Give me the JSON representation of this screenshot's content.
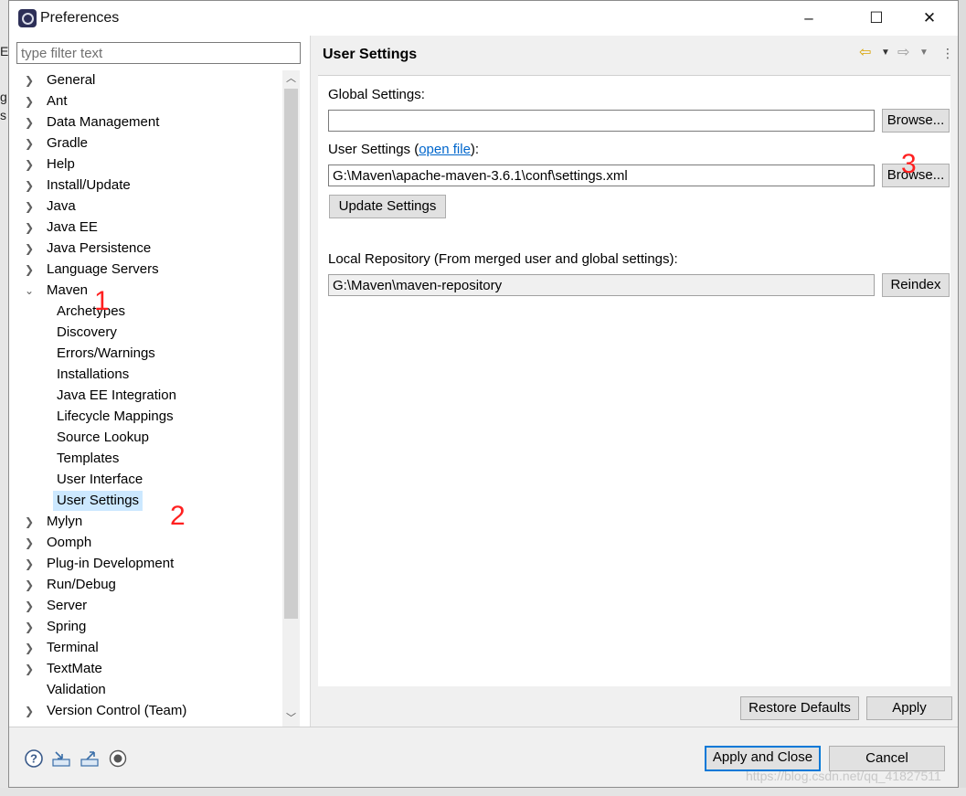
{
  "window": {
    "title": "Preferences",
    "minimize_glyph": "–",
    "maximize_glyph": "☐",
    "close_glyph": "✕"
  },
  "background": {
    "left_letters": [
      "E",
      "g",
      "s"
    ]
  },
  "filter": {
    "placeholder": "type filter text"
  },
  "tree": {
    "items": [
      {
        "label": "General",
        "expandable": true
      },
      {
        "label": "Ant",
        "expandable": true
      },
      {
        "label": "Data Management",
        "expandable": true
      },
      {
        "label": "Gradle",
        "expandable": true
      },
      {
        "label": "Help",
        "expandable": true
      },
      {
        "label": "Install/Update",
        "expandable": true
      },
      {
        "label": "Java",
        "expandable": true
      },
      {
        "label": "Java EE",
        "expandable": true
      },
      {
        "label": "Java Persistence",
        "expandable": true
      },
      {
        "label": "Language Servers",
        "expandable": true
      },
      {
        "label": "Maven",
        "expandable": true,
        "expanded": true
      },
      {
        "label": "Mylyn",
        "expandable": true
      },
      {
        "label": "Oomph",
        "expandable": true
      },
      {
        "label": "Plug-in Development",
        "expandable": true
      },
      {
        "label": "Run/Debug",
        "expandable": true
      },
      {
        "label": "Server",
        "expandable": true
      },
      {
        "label": "Spring",
        "expandable": true
      },
      {
        "label": "Terminal",
        "expandable": true
      },
      {
        "label": "TextMate",
        "expandable": true
      },
      {
        "label": "Validation",
        "expandable": false
      },
      {
        "label": "Version Control (Team)",
        "expandable": true
      }
    ],
    "maven_children": [
      "Archetypes",
      "Discovery",
      "Errors/Warnings",
      "Installations",
      "Java EE Integration",
      "Lifecycle Mappings",
      "Source Lookup",
      "Templates",
      "User Interface",
      "User Settings"
    ],
    "selected": "User Settings"
  },
  "page": {
    "title": "User Settings",
    "global_settings_label": "Global Settings:",
    "global_settings_value": "",
    "browse_label": "Browse...",
    "user_settings_label_prefix": "User Settings (",
    "open_file_link": "open file",
    "user_settings_label_suffix": "):",
    "user_settings_value": "G:\\Maven\\apache-maven-3.6.1\\conf\\settings.xml",
    "update_settings_label": "Update Settings",
    "local_repo_label": "Local Repository (From merged user and global settings):",
    "local_repo_value": "G:\\Maven\\maven-repository",
    "reindex_label": "Reindex",
    "restore_defaults_label": "Restore Defaults",
    "apply_label": "Apply"
  },
  "footer": {
    "apply_close_label": "Apply and Close",
    "cancel_label": "Cancel"
  },
  "annotations": [
    "1",
    "2",
    "3"
  ],
  "watermark": "https://blog.csdn.net/qq_41827511",
  "colors": {
    "selection": "#cce8ff",
    "link": "#0066cc",
    "annotation": "#ff2020",
    "default_button_border": "#0078d7"
  }
}
